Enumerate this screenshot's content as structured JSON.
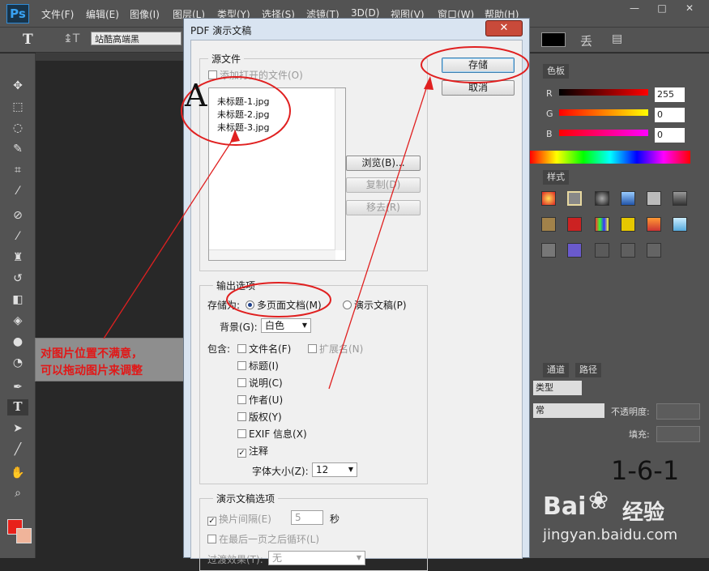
{
  "app": {
    "logo": "Ps",
    "menu": [
      "文件(F)",
      "编辑(E)",
      "图像(I)",
      "图层(L)",
      "类型(Y)",
      "选择(S)",
      "滤镜(T)",
      "3D(D)",
      "视图(V)",
      "窗口(W)",
      "帮助(H)"
    ],
    "window_buttons": [
      "—",
      "□",
      "✕"
    ],
    "font_family": "站酷高端黑",
    "tool_icons": [
      "move-icon",
      "marquee-icon",
      "lasso-icon",
      "quick-select-icon",
      "crop-icon",
      "eyedropper-icon",
      "healing-icon",
      "brush-icon",
      "stamp-icon",
      "history-brush-icon",
      "eraser-icon",
      "paint-bucket-icon",
      "blur-icon",
      "dodge-icon",
      "pen-icon",
      "type-icon",
      "path-select-icon",
      "line-icon",
      "hand-icon",
      "zoom-icon"
    ],
    "colors": {
      "foreground": "#e8201a",
      "background": "#f0b49a"
    }
  },
  "annotation": {
    "line1": "对图片位置不满意，",
    "line2": "可以拖动图片来调整",
    "letter": "A"
  },
  "panels": {
    "color_tab": "色板",
    "styles_tab": "样式",
    "rgb": [
      {
        "label": "R",
        "value": "255"
      },
      {
        "label": "G",
        "value": "0"
      },
      {
        "label": "B",
        "value": "0"
      }
    ],
    "layers_tabs": [
      "通道",
      "路径"
    ],
    "kind": "类型",
    "opacity_label": "不透明度:",
    "fill_label": "填充:",
    "blend_mode": "常"
  },
  "dialog": {
    "title": "PDF 演示文稿",
    "close": "✕",
    "save": "存储",
    "cancel": "取消",
    "source_group": "源文件",
    "add_open_files": "添加打开的文件(O)",
    "files": [
      "未标题-1.jpg",
      "未标题-2.jpg",
      "未标题-3.jpg"
    ],
    "browse": "浏览(B)...",
    "duplicate": "复制(D)",
    "remove": "移去(R)",
    "output_group": "输出选项",
    "save_as_label": "存储为:",
    "multi_page": "多页面文档(M)",
    "presentation": "演示文稿(P)",
    "background_label": "背景(G):",
    "background_value": "白色",
    "include_label": "包含:",
    "options": [
      {
        "label": "文件名(F)",
        "checked": false
      },
      {
        "label": "标题(I)",
        "checked": false
      },
      {
        "label": "说明(C)",
        "checked": false
      },
      {
        "label": "作者(U)",
        "checked": false
      },
      {
        "label": "版权(Y)",
        "checked": false
      },
      {
        "label": "EXIF 信息(X)",
        "checked": false
      },
      {
        "label": "注释",
        "checked": true
      }
    ],
    "extension": "扩展名(N)",
    "font_size_label": "字体大小(Z):",
    "font_size_value": "12",
    "pres_group": "演示文稿选项",
    "advance_every": "换片间隔(E)",
    "advance_value": "5",
    "seconds": "秒",
    "loop": "在最后一页之后循环(L)",
    "transition_label": "过渡效果(T):",
    "transition_value": "无"
  },
  "watermark": {
    "code": "1-6-1",
    "brand_left": "Bai",
    "brand_right": "经验",
    "url": "jingyan.baidu.com"
  }
}
